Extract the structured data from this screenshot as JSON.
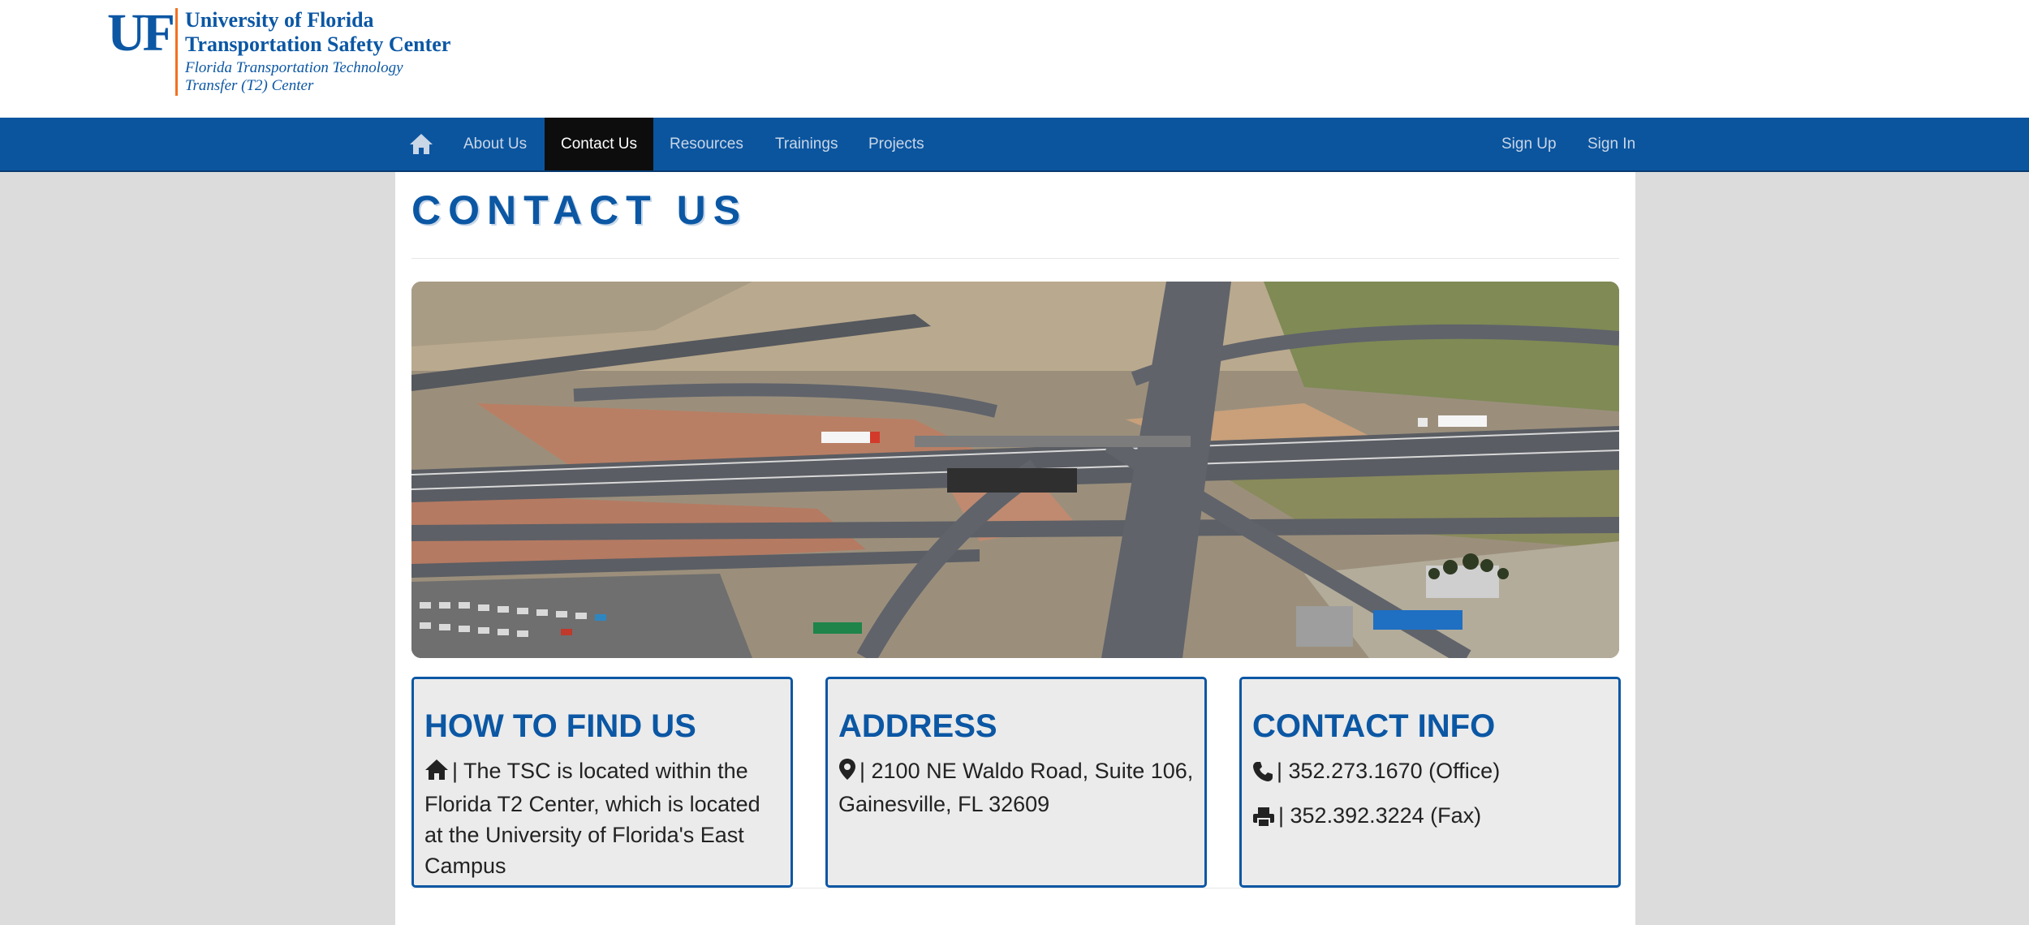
{
  "logo": {
    "mark": "UF",
    "line1": "University of Florida",
    "line2": "Transportation Safety Center",
    "line3": "Florida Transportation Technology",
    "line4": "Transfer (T2) Center"
  },
  "nav": {
    "home_icon": "home-icon",
    "items": [
      {
        "label": "About Us",
        "active": false
      },
      {
        "label": "Contact Us",
        "active": true
      },
      {
        "label": "Resources",
        "active": false
      },
      {
        "label": "Trainings",
        "active": false
      },
      {
        "label": "Projects",
        "active": false
      }
    ],
    "right": [
      {
        "label": "Sign Up"
      },
      {
        "label": "Sign In"
      }
    ]
  },
  "page": {
    "title": "CONTACT US"
  },
  "cards": {
    "find": {
      "heading": "HOW TO FIND US",
      "icon": "home-icon",
      "text": "| The TSC is located within the Florida T2 Center, which is located at the University of Florida's East Campus"
    },
    "address": {
      "heading": "ADDRESS",
      "icon": "map-marker-icon",
      "text": "| 2100 NE Waldo Road, Suite 106, Gainesville, FL 32609"
    },
    "contact": {
      "heading": "CONTACT INFO",
      "phone_icon": "phone-icon",
      "phone": "| 352.273.1670 (Office)",
      "fax_icon": "printer-icon",
      "fax": "| 352.392.3224 (Fax)"
    }
  },
  "colors": {
    "brand_blue": "#0b57a4",
    "nav_blue": "#0b559f",
    "accent_orange": "#f37021",
    "active_nav": "#0d0d0d",
    "page_bg": "#dcdcdc"
  }
}
